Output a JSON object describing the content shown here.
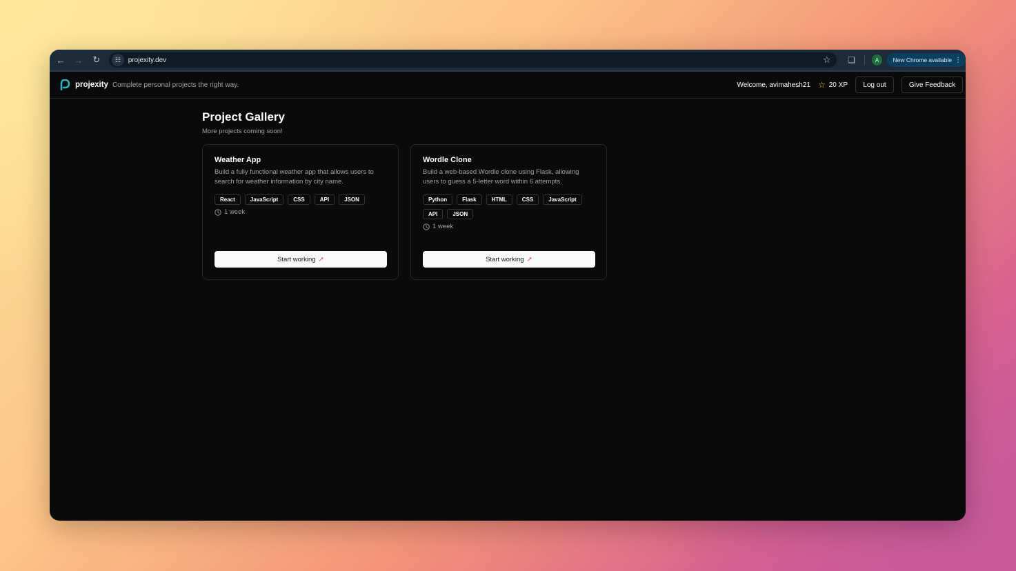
{
  "browser": {
    "url": "projexity.dev",
    "new_chrome_label": "New Chrome available",
    "profile_initial": "A"
  },
  "header": {
    "brand": "projexity",
    "tagline": "Complete personal projects the right way.",
    "welcome": "Welcome, avimahesh21",
    "xp": "20 XP",
    "logout_label": "Log out",
    "feedback_label": "Give Feedback"
  },
  "gallery": {
    "title": "Project Gallery",
    "subtitle": "More projects coming soon!",
    "projects": [
      {
        "title": "Weather App",
        "description": "Build a fully functional weather app that allows users to search for weather information by city name.",
        "tags": [
          "React",
          "JavaScript",
          "CSS",
          "API",
          "JSON"
        ],
        "duration": "1 week",
        "button_label": "Start working"
      },
      {
        "title": "Wordle Clone",
        "description": "Build a web-based Wordle clone using Flask, allowing users to guess a 5-letter word within 6 attempts.",
        "tags": [
          "Python",
          "Flask",
          "HTML",
          "CSS",
          "JavaScript",
          "API",
          "JSON"
        ],
        "duration": "1 week",
        "button_label": "Start working"
      }
    ]
  },
  "icons": {
    "back": "arrow-left-icon",
    "forward": "arrow-right-icon",
    "reload": "reload-icon",
    "site_info": "tune-icon",
    "bookmark": "star-outline-icon",
    "extensions": "puzzle-icon",
    "menu": "kebab-icon",
    "xp": "star-icon",
    "duration": "clock-icon",
    "start": "rocket-icon"
  },
  "colors": {
    "page_bg": "#0a0a0a",
    "chrome_bg": "#1d2a38",
    "xp_star": "#f5c518",
    "logo": "#2bb3c0",
    "button_bg": "#fafafa"
  }
}
